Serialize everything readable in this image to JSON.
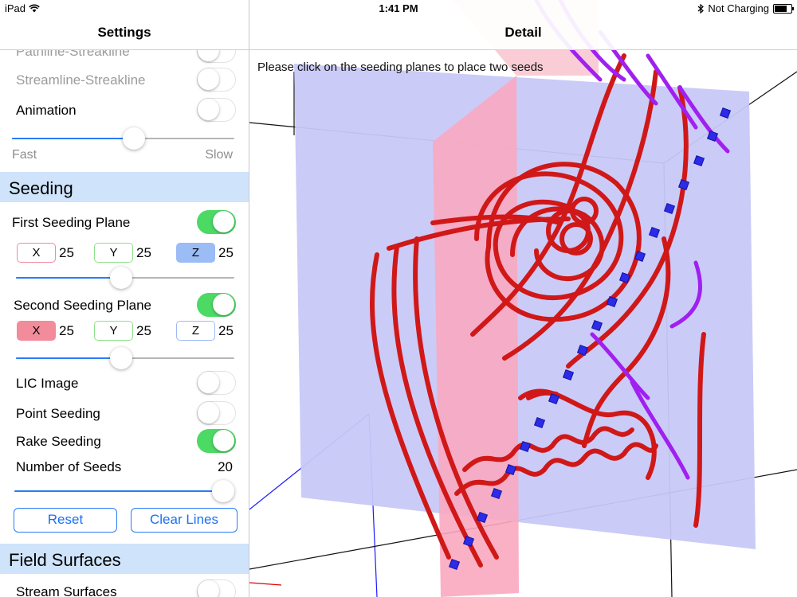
{
  "status_bar": {
    "device": "iPad",
    "time": "1:41 PM",
    "charging": "Not Charging",
    "battery_level": 0.85
  },
  "sidebar": {
    "title": "Settings",
    "partial_row_label": "Pathline-Streakline",
    "streamline_streakline_label": "Streamline-Streakline",
    "animation": {
      "label": "Animation",
      "on": false
    },
    "speed_slider": {
      "value": 0.55,
      "min_label": "Fast",
      "max_label": "Slow"
    },
    "seeding": {
      "header": "Seeding",
      "first_plane": {
        "label": "First Seeding Plane",
        "on": true,
        "x_label": "X",
        "x_value": "25",
        "y_label": "Y",
        "y_value": "25",
        "z_label": "Z",
        "z_value": "25",
        "selected_axis": "Z",
        "slider_value": 0.48
      },
      "second_plane": {
        "label": "Second Seeding Plane",
        "on": true,
        "x_label": "X",
        "x_value": "25",
        "y_label": "Y",
        "y_value": "25",
        "z_label": "Z",
        "z_value": "25",
        "selected_axis": "X",
        "slider_value": 0.48
      },
      "lic_image": {
        "label": "LIC Image",
        "on": false
      },
      "point_seeding": {
        "label": "Point Seeding",
        "on": false
      },
      "rake_seeding": {
        "label": "Rake Seeding",
        "on": true
      },
      "number_of_seeds": {
        "label": "Number of Seeds",
        "value": "20",
        "slider_value": 1.0
      },
      "reset_label": "Reset",
      "clear_lines_label": "Clear Lines"
    },
    "field_surfaces": {
      "header": "Field Surfaces",
      "stream_surfaces": {
        "label": "Stream Surfaces",
        "on": false
      }
    }
  },
  "detail": {
    "title": "Detail",
    "instructions": "Please click on the seeding planes to place two seeds"
  },
  "colors": {
    "accent_blue": "#2a7cf6",
    "switch_on": "#4cd964",
    "section_header_bg": "#cfe3fa",
    "plane_blue": "#c8c8f8",
    "plane_pink": "#f9a8c0",
    "streamline_red": "#e02020",
    "streamline_purple": "#a020f0",
    "seed_blue": "#2b2be8"
  }
}
